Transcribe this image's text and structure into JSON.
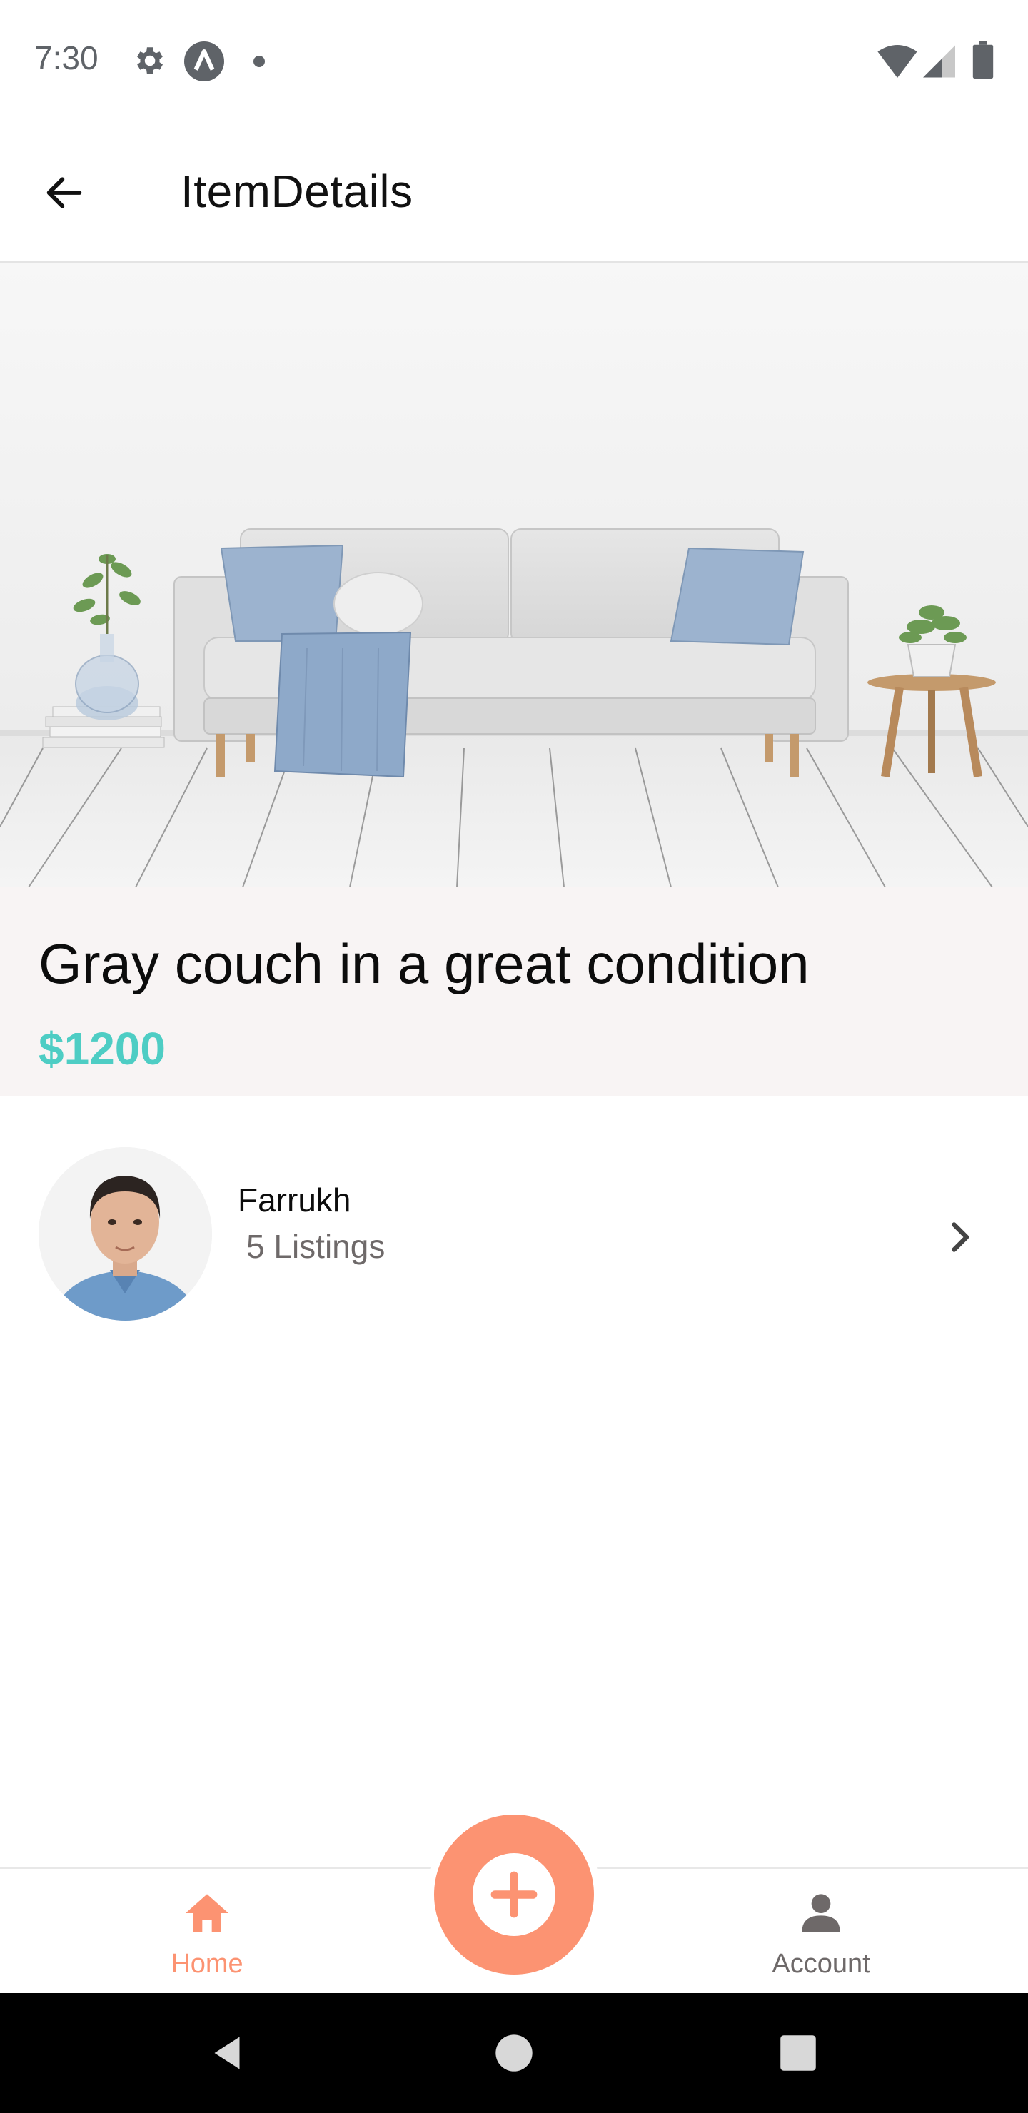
{
  "status_bar": {
    "time": "7:30",
    "icons": [
      "gear-icon",
      "app-logo-icon",
      "dot-icon",
      "wifi-icon",
      "signal-icon",
      "battery-icon"
    ]
  },
  "app_bar": {
    "title": "ItemDetails",
    "back_icon": "arrow-left-icon"
  },
  "item": {
    "image": "gray-couch-photo",
    "title": "Gray couch in a great condition",
    "price": "$1200"
  },
  "seller": {
    "name": "Farrukh",
    "listings": "5 Listings",
    "chevron_icon": "chevron-right-icon"
  },
  "tab_bar": {
    "tabs": [
      {
        "label": "Home",
        "icon": "home-icon",
        "active": true
      },
      {
        "label": "Account",
        "icon": "account-icon",
        "active": false
      }
    ],
    "fab_icon": "plus-circle-icon"
  },
  "colors": {
    "accent": "#fc9372",
    "price": "#4ecdc4",
    "info_background": "#f8f4f4",
    "muted_text": "#6e6969"
  }
}
